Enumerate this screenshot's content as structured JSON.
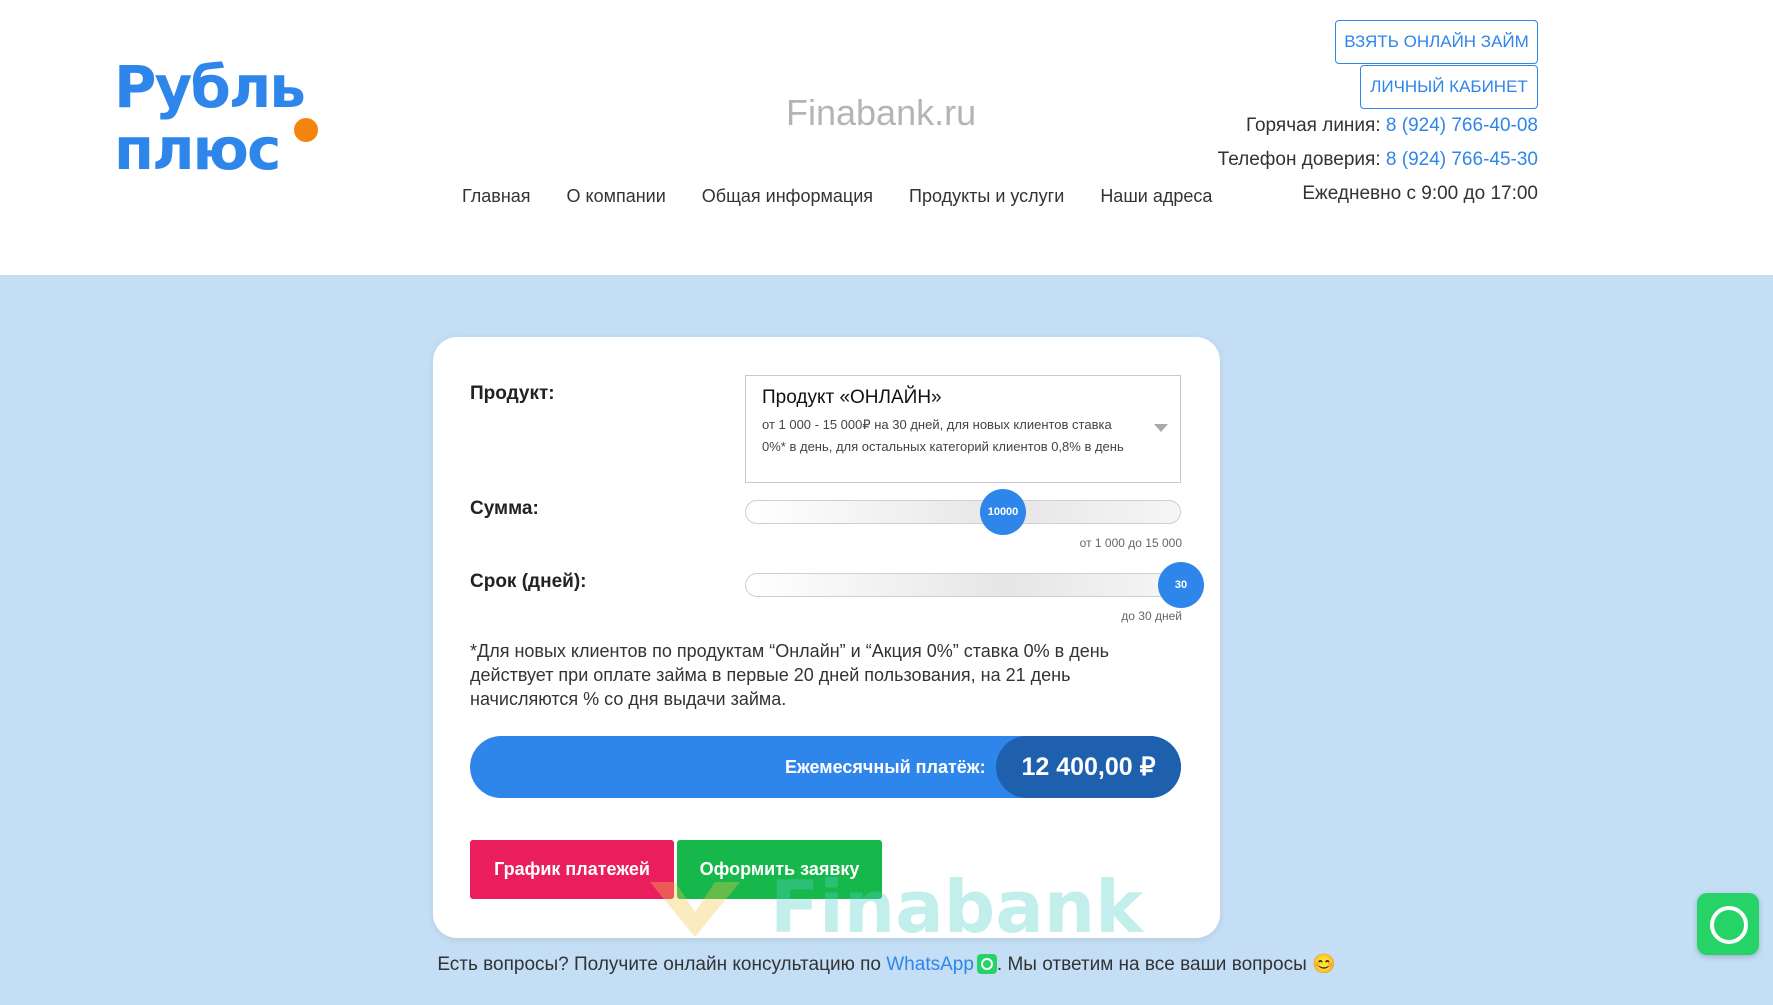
{
  "header": {
    "logo_line1": "Рубль",
    "logo_line2": "плюс",
    "site_name": "Finabank.ru",
    "nav": [
      "Главная",
      "О компании",
      "Общая информация",
      "Продукты и услуги",
      "Наши адреса"
    ],
    "btn_loan": "ВЗЯТЬ ОНЛАЙН ЗАЙМ",
    "btn_cabinet": "ЛИЧНЫЙ КАБИНЕТ",
    "hotline_label": "Горячая линия:",
    "hotline_phone": "8 (924) 766-40-08",
    "trust_label": "Телефон доверия:",
    "trust_phone": "8 (924) 766-45-30",
    "hours": "Ежедневно с 9:00 до 17:00"
  },
  "calculator": {
    "product_label": "Продукт:",
    "product_title": "Продукт «ОНЛАЙН»",
    "product_desc": "от 1 000 - 15 000₽ на 30 дней, для новых клиентов ставка 0%* в день, для остальных категорий клиентов 0,8% в день",
    "sum_label": "Сумма:",
    "sum_value": "10000",
    "sum_fraction": 0.6,
    "sum_hint": "от 1 000 до 15 000",
    "term_label": "Срок (дней):",
    "term_value": "30",
    "term_fraction": 1.0,
    "term_hint": "до 30 дней",
    "note": "*Для новых клиентов по продуктам “Онлайн” и “Акция 0%” ставка 0% в день действует при оплате займа в первые 20 дней пользования, на 21 день начисляются % со дня выдачи займа.",
    "payment_label": "Ежемесячный платёж:",
    "payment_value": "12 400,00 ₽",
    "btn_schedule": "График платежей",
    "btn_apply": "Оформить заявку"
  },
  "watermark": "Finabank",
  "footer": {
    "text_before": "Есть вопросы? Получите онлайн консультацию по ",
    "link": "WhatsApp",
    "text_after": ". Мы ответим на все ваши вопросы 😊"
  },
  "colors": {
    "accent": "#2f86ea",
    "band": "#c4def5",
    "schedule": "#ea1d5d",
    "apply": "#16b84b",
    "logo_dot": "#f5840f"
  }
}
